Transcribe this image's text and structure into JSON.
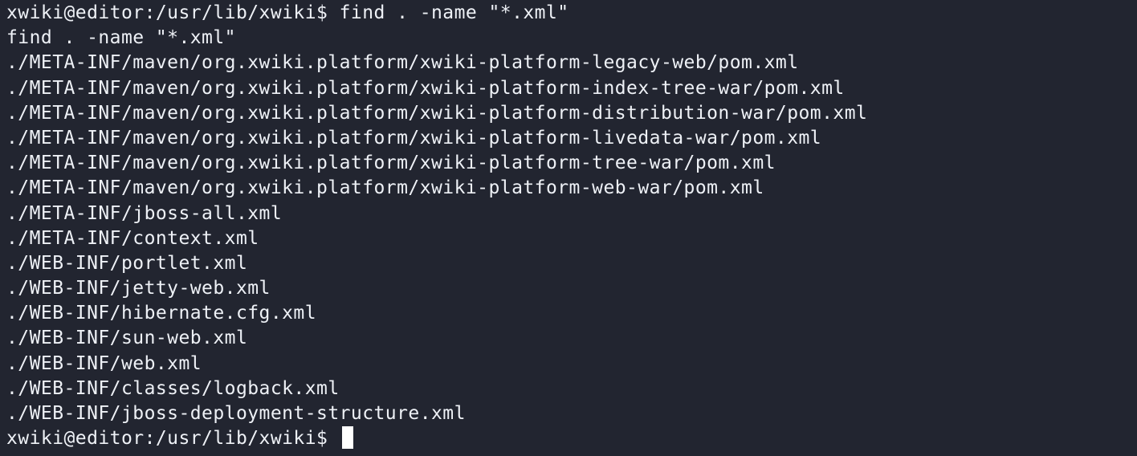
{
  "terminal": {
    "lines": [
      "xwiki@editor:/usr/lib/xwiki$ find . -name \"*.xml\"",
      "find . -name \"*.xml\"",
      "./META-INF/maven/org.xwiki.platform/xwiki-platform-legacy-web/pom.xml",
      "./META-INF/maven/org.xwiki.platform/xwiki-platform-index-tree-war/pom.xml",
      "./META-INF/maven/org.xwiki.platform/xwiki-platform-distribution-war/pom.xml",
      "./META-INF/maven/org.xwiki.platform/xwiki-platform-livedata-war/pom.xml",
      "./META-INF/maven/org.xwiki.platform/xwiki-platform-tree-war/pom.xml",
      "./META-INF/maven/org.xwiki.platform/xwiki-platform-web-war/pom.xml",
      "./META-INF/jboss-all.xml",
      "./META-INF/context.xml",
      "./WEB-INF/portlet.xml",
      "./WEB-INF/jetty-web.xml",
      "./WEB-INF/hibernate.cfg.xml",
      "./WEB-INF/sun-web.xml",
      "./WEB-INF/web.xml",
      "./WEB-INF/classes/logback.xml",
      "./WEB-INF/jboss-deployment-structure.xml"
    ],
    "prompt": "xwiki@editor:/usr/lib/xwiki$ "
  },
  "colors": {
    "background": "#222530",
    "foreground": "#eef1f6",
    "cursor": "#ffffff"
  }
}
